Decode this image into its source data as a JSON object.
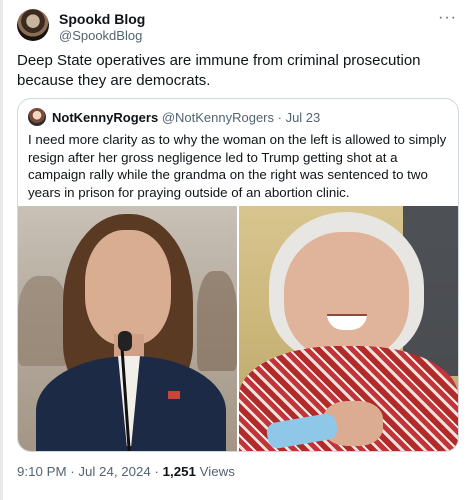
{
  "tweet": {
    "author_name": "Spookd Blog",
    "author_handle": "@SpookdBlog",
    "more_icon": "more-horizontal-icon",
    "text": "Deep State operatives are immune from criminal prosecution because they are democrats."
  },
  "quote": {
    "author_name": "NotKennyRogers",
    "author_handle": "@NotKennyRogers",
    "separator": " · ",
    "date": "Jul 23",
    "text": "I need more clarity as to why the woman on the left is allowed to simply resign after her gross negligence led to Trump getting shot at a campaign rally while the grandma on the right was sentenced to two years in prison for praying outside of an abortion clinic."
  },
  "meta": {
    "time": "9:10 PM",
    "separator1": " · ",
    "date": "Jul 24, 2024",
    "separator2": " · ",
    "views_count": "1,251",
    "views_label": " Views"
  }
}
